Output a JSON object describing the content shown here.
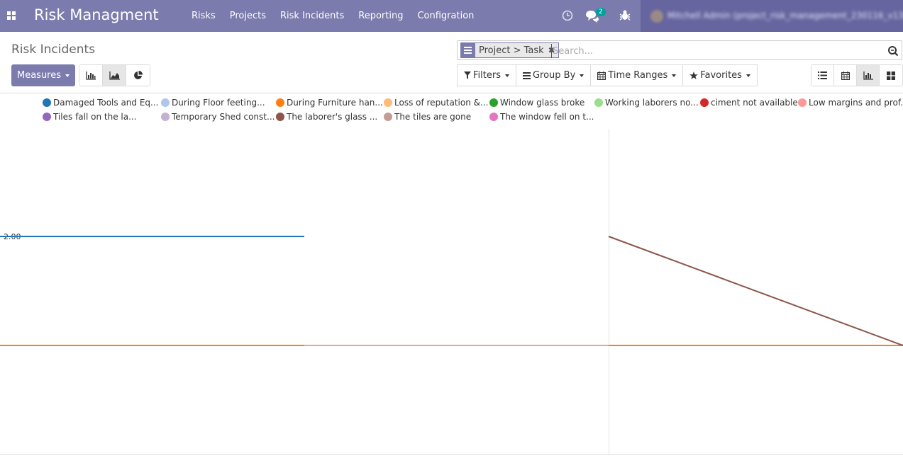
{
  "navbar": {
    "app_title": "Risk Managment",
    "menu": [
      "Risks",
      "Projects",
      "Risk Incidents",
      "Reporting",
      "Configration"
    ],
    "icons": [
      "apps-grid-icon",
      "clock-icon",
      "chat-icon",
      "bug-icon"
    ],
    "chat_badge": "2",
    "user_text": "Mitchell Admin (project_risk_management_230116_v13)"
  },
  "control_panel": {
    "title": "Risk Incidents",
    "measures_label": "Measures",
    "chart_type_active": "line",
    "search": {
      "facet_label": "Project > Task",
      "placeholder": "Search..."
    },
    "filters": {
      "filters_label": "Filters",
      "groupby_label": "Group By",
      "timeranges_label": "Time Ranges",
      "favorites_label": "Favorites"
    },
    "views": [
      "list-view-icon",
      "calendar-view-icon",
      "graph-view-icon",
      "kanban-view-icon"
    ],
    "active_view": "graph"
  },
  "colors": {
    "navbar": "#7c7bad",
    "accent": "#7c7bad"
  },
  "chart_data": {
    "type": "line",
    "categories": [
      "",
      "",
      ""
    ],
    "ylim": [
      0,
      3
    ],
    "y_tick_labels": [
      "2.00"
    ],
    "legend_position": "top",
    "series": [
      {
        "name": "Damaged Tools and Eq...",
        "color": "#1f77b4",
        "values": [
          2,
          2,
          null
        ]
      },
      {
        "name": "During Floor feeting...",
        "color": "#aec7e8",
        "values": [
          null,
          null,
          null
        ]
      },
      {
        "name": "During Furniture han...",
        "color": "#ff7f0e",
        "values": [
          1,
          1,
          1
        ]
      },
      {
        "name": "Loss of reputation &...",
        "color": "#ffbb78",
        "values": [
          null,
          null,
          null
        ]
      },
      {
        "name": "Window glass broke",
        "color": "#2ca02c",
        "values": [
          null,
          null,
          null
        ]
      },
      {
        "name": "Working laborers no...",
        "color": "#98df8a",
        "values": [
          null,
          null,
          null
        ]
      },
      {
        "name": "ciment not available",
        "color": "#d62728",
        "values": [
          null,
          null,
          null
        ]
      },
      {
        "name": "Low margins and prof...",
        "color": "#ff9896",
        "values": [
          null,
          1,
          null
        ]
      },
      {
        "name": "Tiles fall on the la...",
        "color": "#9467bd",
        "values": [
          null,
          null,
          null
        ]
      },
      {
        "name": "Temporary Shed const...",
        "color": "#c5b0d5",
        "values": [
          null,
          null,
          null
        ]
      },
      {
        "name": "The laborer's glass ...",
        "color": "#8c564b",
        "values": [
          null,
          2,
          1
        ]
      },
      {
        "name": "The tiles are gone",
        "color": "#c49c94",
        "values": [
          null,
          null,
          null
        ]
      },
      {
        "name": "The window fell on t...",
        "color": "#e377c2",
        "values": [
          null,
          null,
          null
        ]
      }
    ]
  }
}
